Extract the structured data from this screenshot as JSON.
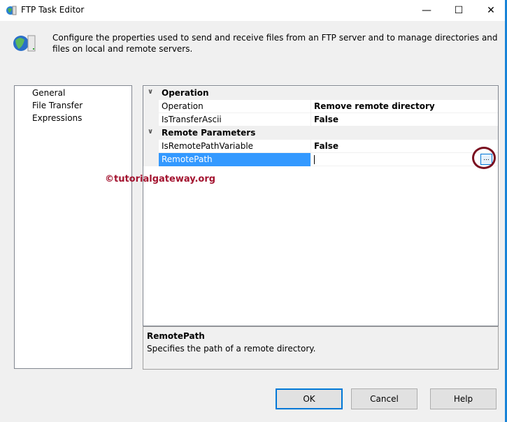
{
  "window": {
    "title": "FTP Task Editor",
    "minimize": "—",
    "maximize": "☐",
    "close": "✕"
  },
  "header": {
    "description": "Configure the properties used to send and receive files from an FTP server and to manage directories and files on local and remote servers."
  },
  "nav": {
    "items": [
      {
        "label": "General"
      },
      {
        "label": "File Transfer"
      },
      {
        "label": "Expressions"
      }
    ],
    "selected": "File Transfer"
  },
  "grid": {
    "categories": [
      {
        "label": "Operation",
        "props": [
          {
            "name": "Operation",
            "value": "Remove remote directory"
          },
          {
            "name": "IsTransferAscii",
            "value": "False"
          }
        ]
      },
      {
        "label": "Remote Parameters",
        "props": [
          {
            "name": "IsRemotePathVariable",
            "value": "False"
          },
          {
            "name": "RemotePath",
            "value": ""
          }
        ]
      }
    ],
    "ellipsis": "...",
    "selection_color": "#3399ff"
  },
  "help": {
    "title": "RemotePath",
    "text": "Specifies the path of a remote directory."
  },
  "watermark": "©tutorialgateway.org",
  "buttons": {
    "ok": "OK",
    "cancel": "Cancel",
    "help": "Help"
  }
}
